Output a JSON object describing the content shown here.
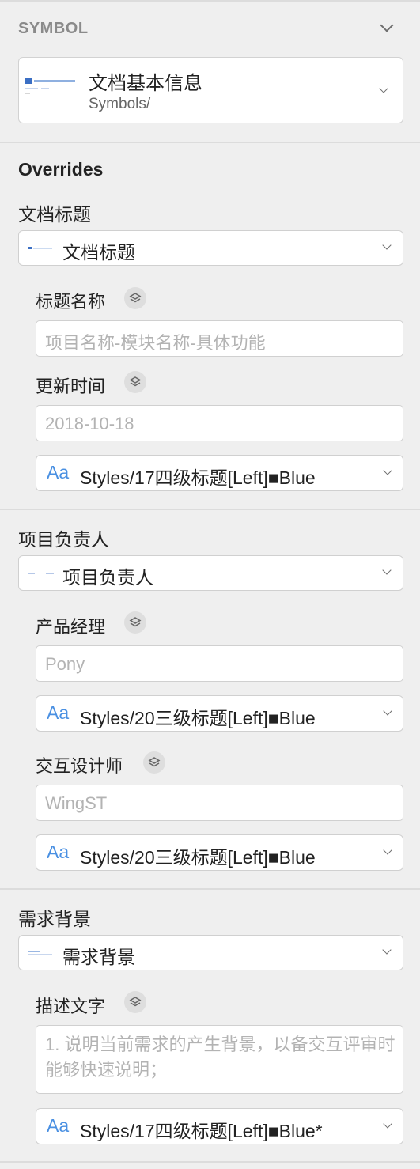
{
  "symbol_section": {
    "title": "SYMBOL",
    "card_name": "文档基本信息",
    "card_path": "Symbols/"
  },
  "overrides": {
    "title": "Overrides",
    "groups": [
      {
        "label": "文档标题",
        "dropdown": "文档标题",
        "fields": [
          {
            "label": "标题名称",
            "placeholder": "项目名称-模块名称-具体功能"
          },
          {
            "label": "更新时间",
            "placeholder": "2018-10-18"
          }
        ],
        "style": {
          "aa": "Aa",
          "label": "Styles/17四级标题[Left]■Blue"
        }
      },
      {
        "label": "项目负责人",
        "dropdown": "项目负责人",
        "fields": [
          {
            "label": "产品经理",
            "placeholder": "Pony",
            "style": {
              "aa": "Aa",
              "label": "Styles/20三级标题[Left]■Blue"
            }
          },
          {
            "label": "交互设计师",
            "placeholder": "WingST",
            "style": {
              "aa": "Aa",
              "label": "Styles/20三级标题[Left]■Blue"
            }
          }
        ]
      },
      {
        "label": "需求背景",
        "dropdown": "需求背景",
        "fields": [
          {
            "label": "描述文字",
            "placeholder": "1. 说明当前需求的产生背景，以备交互评审时能够快速说明；"
          }
        ],
        "style": {
          "aa": "Aa",
          "label": "Styles/17四级标题[Left]■Blue*"
        }
      }
    ]
  },
  "colors": {
    "accent": "#4a90e2",
    "background": "#efefef",
    "placeholder": "#b3b3b3"
  }
}
